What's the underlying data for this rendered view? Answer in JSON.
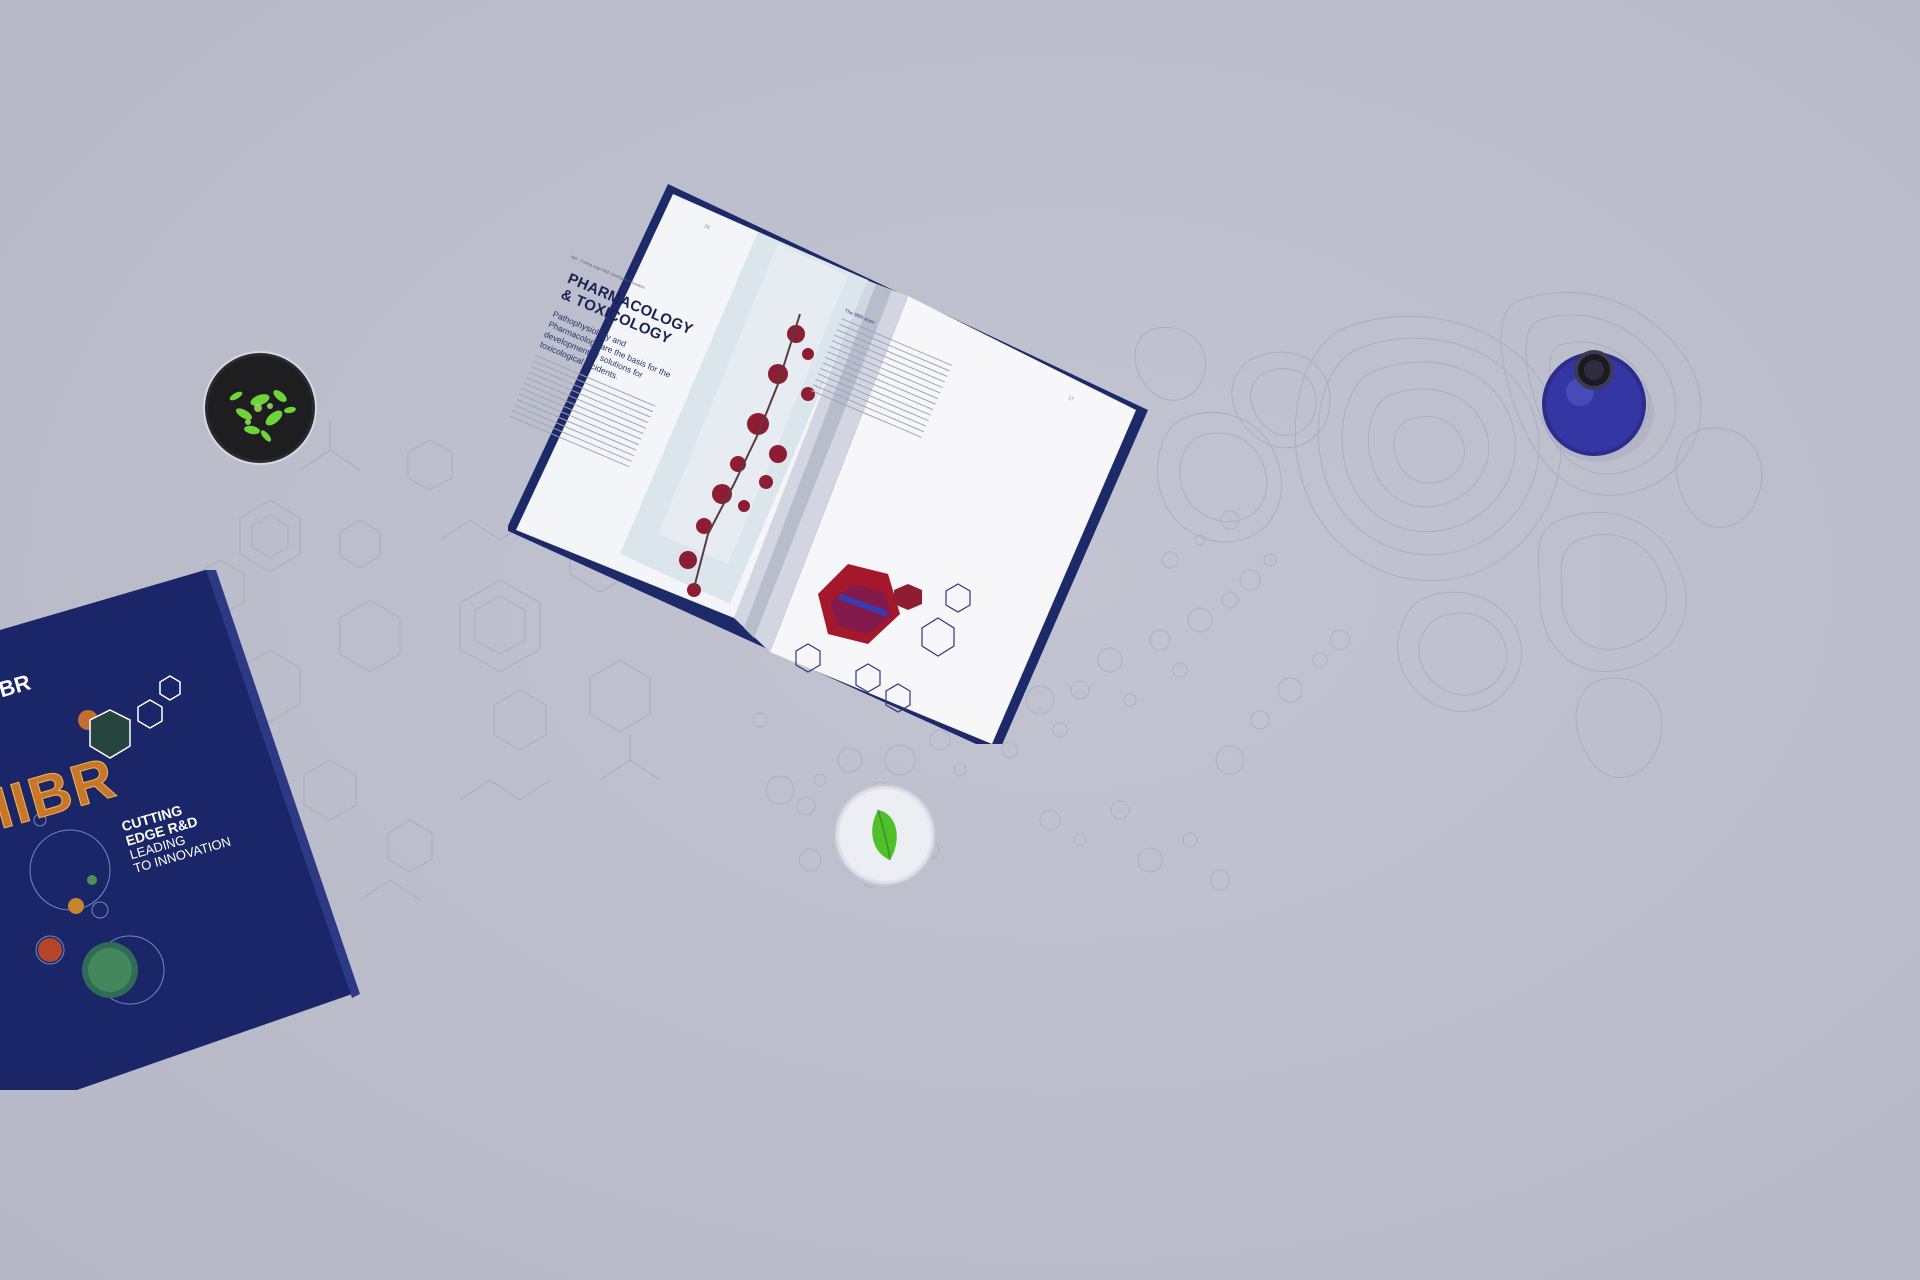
{
  "scene": {
    "background_color": "#bbbdcb",
    "accent_navy": "#1d2a6c",
    "accent_red": "#9b1c2e"
  },
  "open_book": {
    "header": "IBR · Cutting edge R&D leading to innovation",
    "title_line1": "PHARMACOLOGY",
    "title_line2": "& TOXICOLOGY",
    "intro": "Pathophysiology and Pharmacology are the basis for the development of solutions for toxicological incidents.",
    "section_heading": "The IIBR team",
    "page_left_number": "16",
    "page_right_number": "17"
  },
  "closed_book": {
    "logo": "IBR",
    "big_letters": "IIBR",
    "line1": "CUTTING",
    "line2": "EDGE R&D",
    "line3": "LEADING",
    "line4": "TO INNOVATION"
  },
  "objects": {
    "plant_dish": "petri-dish-with-plant",
    "leaf_dish": "petri-dish-with-leaf",
    "flask": "round-bottom-flask-blue"
  }
}
